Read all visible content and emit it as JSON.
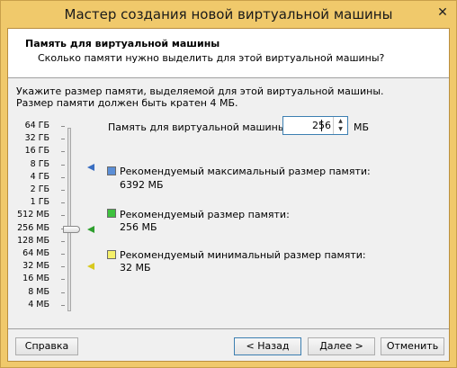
{
  "window": {
    "title": "Мастер создания новой виртуальной машины",
    "close_glyph": "✕",
    "close_icon": "close-icon"
  },
  "header": {
    "title": "Память для виртуальной машины",
    "subtitle": "Сколько памяти нужно выделить для этой виртуальной машины?"
  },
  "description": [
    "Укажите размер памяти, выделяемой для этой виртуальной машины.",
    "Размер памяти должен быть кратен 4 МБ."
  ],
  "memory_field": {
    "label": "Память для виртуальной машины:",
    "value": "256",
    "unit": "МБ"
  },
  "scale": {
    "labels": [
      "64 ГБ",
      "32 ГБ",
      "16 ГБ",
      "8 ГБ",
      "4 ГБ",
      "2 ГБ",
      "1 ГБ",
      "512 МБ",
      "256 МБ",
      "128 МБ",
      "64 МБ",
      "32 МБ",
      "16 МБ",
      "8 МБ",
      "4 МБ"
    ],
    "slider_value": "256 МБ"
  },
  "recommendations": {
    "max": {
      "title": "Рекомендуемый максимальный размер памяти:",
      "value": "6392 МБ",
      "color": "#5b8ed6"
    },
    "recommended": {
      "title": "Рекомендуемый размер памяти:",
      "value": "256 МБ",
      "color": "#3ec13e"
    },
    "min": {
      "title": "Рекомендуемый минимальный размер памяти:",
      "value": "32 МБ",
      "color": "#f5f06a"
    }
  },
  "buttons": {
    "help": "Справка",
    "back": "< Назад",
    "next": "Далее >",
    "cancel": "Отменить"
  }
}
